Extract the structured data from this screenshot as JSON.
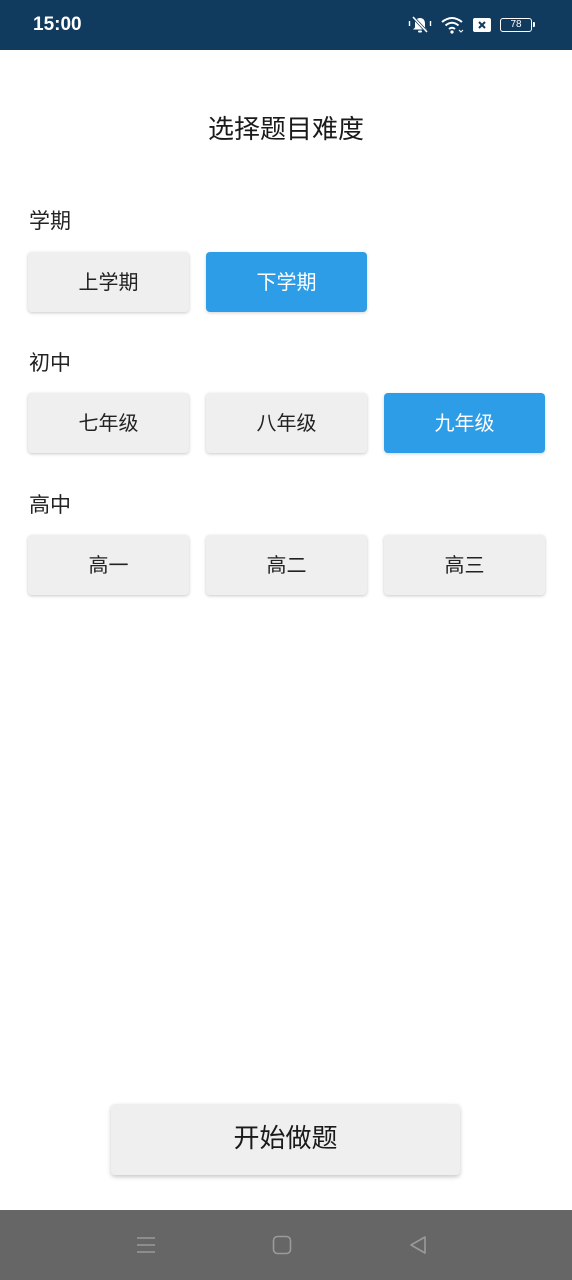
{
  "status_bar": {
    "time": "15:00",
    "battery_level": "78",
    "icons": [
      "mute-vibrate-icon",
      "wifi-icon",
      "sim-blocked-icon",
      "battery-icon"
    ]
  },
  "page": {
    "title": "选择题目难度"
  },
  "semester": {
    "label": "学期",
    "options": [
      {
        "label": "上学期",
        "selected": false
      },
      {
        "label": "下学期",
        "selected": true
      }
    ]
  },
  "junior_high": {
    "label": "初中",
    "options": [
      {
        "label": "七年级",
        "selected": false
      },
      {
        "label": "八年级",
        "selected": false
      },
      {
        "label": "九年级",
        "selected": true
      }
    ]
  },
  "senior_high": {
    "label": "高中",
    "options": [
      {
        "label": "高一",
        "selected": false
      },
      {
        "label": "高二",
        "selected": false
      },
      {
        "label": "高三",
        "selected": false
      }
    ]
  },
  "actions": {
    "start_label": "开始做题"
  },
  "nav_bar": {
    "icons": [
      "menu-icon",
      "home-icon",
      "back-icon"
    ]
  },
  "colors": {
    "status_bar_bg": "#103a5e",
    "selected_accent": "#2d9de8",
    "button_bg": "#efefef",
    "nav_bar_bg": "#666666"
  }
}
